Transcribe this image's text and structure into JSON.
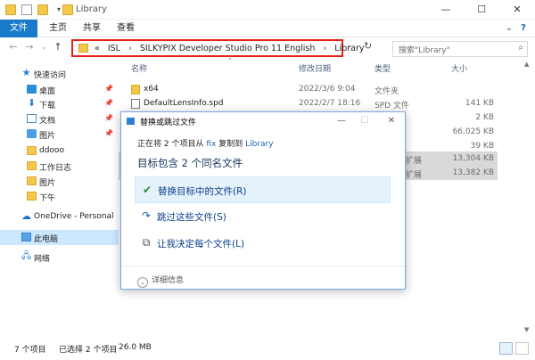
{
  "window": {
    "title": "Library",
    "controls": {
      "minimize": "—",
      "maximize": "☐",
      "close": "✕"
    }
  },
  "ribbon": {
    "tabs": [
      "文件",
      "主页",
      "共享",
      "查看"
    ],
    "expand": "⌄",
    "help": "?"
  },
  "address": {
    "overflow": "«",
    "segments": [
      "ISL",
      "SILKYPIX Developer Studio Pro 11 English",
      "Library"
    ],
    "separator": "›",
    "dropdown": "⌄",
    "refresh": "↻",
    "highlight_color": "#e8221b"
  },
  "search": {
    "placeholder": "搜索\"Library\""
  },
  "sidebar": {
    "items": [
      {
        "label": "快速访问",
        "icon": "star-icon"
      },
      {
        "label": "桌面",
        "icon": "desktop-icon",
        "pinned": true
      },
      {
        "label": "下载",
        "icon": "download-icon",
        "pinned": true
      },
      {
        "label": "文档",
        "icon": "document-icon",
        "pinned": true
      },
      {
        "label": "图片",
        "icon": "pictures-icon",
        "pinned": true
      },
      {
        "label": "ddooo",
        "icon": "folder-icon"
      },
      {
        "label": "工作日志",
        "icon": "folder-icon"
      },
      {
        "label": "图片",
        "icon": "folder-icon"
      },
      {
        "label": "下午",
        "icon": "folder-icon"
      },
      {
        "label": "OneDrive - Personal",
        "icon": "onedrive-icon"
      },
      {
        "label": "此电脑",
        "icon": "pc-icon",
        "selected": true
      },
      {
        "label": "网络",
        "icon": "network-icon"
      }
    ]
  },
  "filelist": {
    "columns": [
      "名称",
      "修改日期",
      "类型",
      "大小"
    ],
    "rows": [
      {
        "name": "x64",
        "date": "2022/3/6 9:04",
        "type": "文件夹",
        "size": ""
      },
      {
        "name": "DefaultLensInfo.spd",
        "date": "2022/2/7 18:16",
        "type": "SPD 文件",
        "size": "141 KB"
      },
      {
        "name": "",
        "date": "",
        "type": "",
        "size": "2 KB"
      },
      {
        "name": "",
        "date": "",
        "type": "",
        "size": "66,025 KB"
      },
      {
        "name": "",
        "date": "",
        "type": "",
        "size": "39 KB"
      },
      {
        "name": "",
        "date": "",
        "type": "扩展",
        "size": "13,304 KB",
        "highlight": true
      },
      {
        "name": "",
        "date": "",
        "type": "扩展",
        "size": "13,382 KB",
        "highlight": true
      }
    ]
  },
  "statusbar": {
    "count": "7 个项目",
    "selected": "已选择 2 个项目",
    "size": "26.0 MB"
  },
  "dialog": {
    "title": "替换或跳过文件",
    "status_prefix": "正在将 2 个项目从",
    "source": "fix",
    "status_middle": "复制到",
    "destination": "Library",
    "heading": "目标包含 2 个同名文件",
    "options": [
      {
        "icon": "check-icon",
        "glyph": "✔",
        "label": "替换目标中的文件(R)",
        "selected": true
      },
      {
        "icon": "skip-icon",
        "glyph": "↷",
        "label": "跳过这些文件(S)",
        "selected": false
      },
      {
        "icon": "decide-icon",
        "glyph": "⧉",
        "label": "让我决定每个文件(L)",
        "selected": false
      }
    ],
    "more_details": "详细信息",
    "controls": {
      "minimize": "—",
      "maximize": "☐",
      "close": "✕"
    }
  }
}
